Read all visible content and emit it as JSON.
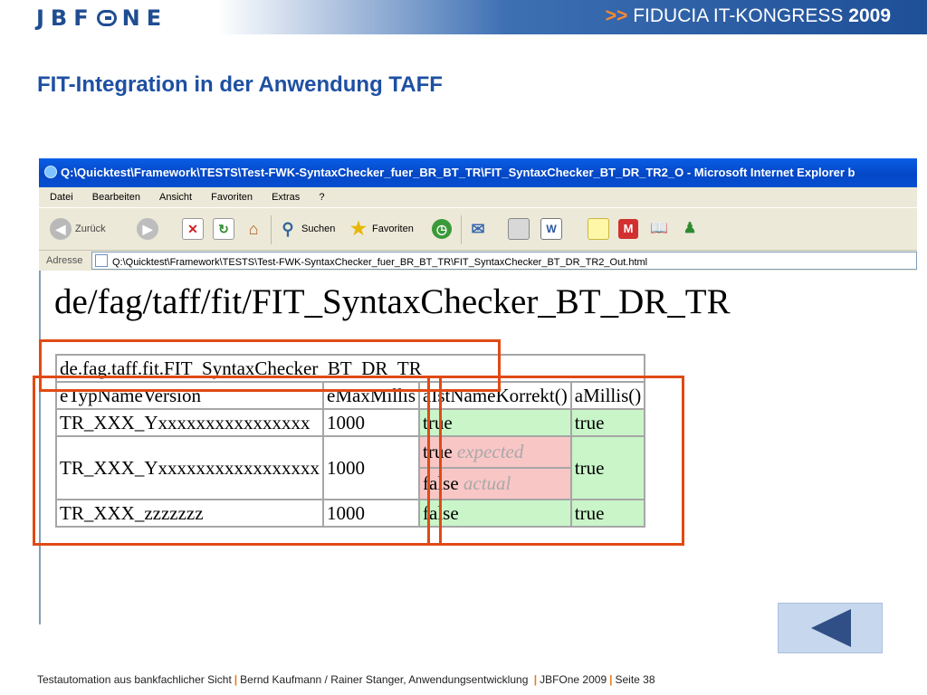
{
  "header": {
    "logo": "JBFONE",
    "congress_arrow": ">>",
    "congress_text": "FIDUCIA IT-KONGRESS",
    "congress_year": "2009"
  },
  "slide_title": "FIT-Integration in der Anwendung TAFF",
  "browser": {
    "title": "Q:\\Quicktest\\Framework\\TESTS\\Test-FWK-SyntaxChecker_fuer_BR_BT_TR\\FIT_SyntaxChecker_BT_DR_TR2_O - Microsoft Internet Explorer b",
    "menu": [
      "Datei",
      "Bearbeiten",
      "Ansicht",
      "Favoriten",
      "Extras",
      "?"
    ],
    "toolbar": {
      "back": "Zurück",
      "search": "Suchen",
      "favorites": "Favoriten"
    },
    "address_label": "Adresse",
    "address": "Q:\\Quicktest\\Framework\\TESTS\\Test-FWK-SyntaxChecker_fuer_BR_BT_TR\\FIT_SyntaxChecker_BT_DR_TR2_Out.html",
    "colors": {
      "right": "#c9f5c9",
      "wrong": "#f9c6c6",
      "highlight_box": "#e04a14"
    }
  },
  "page": {
    "heading": "de/fag/taff/fit/FIT_SyntaxChecker_BT_DR_TR",
    "fixture": "de.fag.taff.fit.FIT_SyntaxChecker_BT_DR_TR",
    "columns": [
      "eTypNameVersion",
      "eMaxMillis",
      "aIstNameKorrekt()",
      "aMillis()"
    ],
    "rows": [
      {
        "name": "TR_XXX_Yxxxxxxxxxxxxxxxx",
        "millis": "1000",
        "korrekt": "true",
        "amillis": "true"
      },
      {
        "name": "TR_XXX_Yxxxxxxxxxxxxxxxxx",
        "millis": "1000",
        "korrekt_expected": "true",
        "expected_label": "expected",
        "korrekt_actual": "false",
        "actual_label": "actual",
        "amillis": "true"
      },
      {
        "name": "TR_XXX_zzzzzzz",
        "millis": "1000",
        "korrekt": "false",
        "amillis": "true"
      }
    ]
  },
  "footer": {
    "part1": "Testautomation aus bankfachlicher Sicht",
    "part2": "Bernd Kaufmann / Rainer Stanger,  Anwendungsentwicklung",
    "part3": "JBFOne 2009",
    "part4": "Seite 38",
    "separator": "|"
  }
}
